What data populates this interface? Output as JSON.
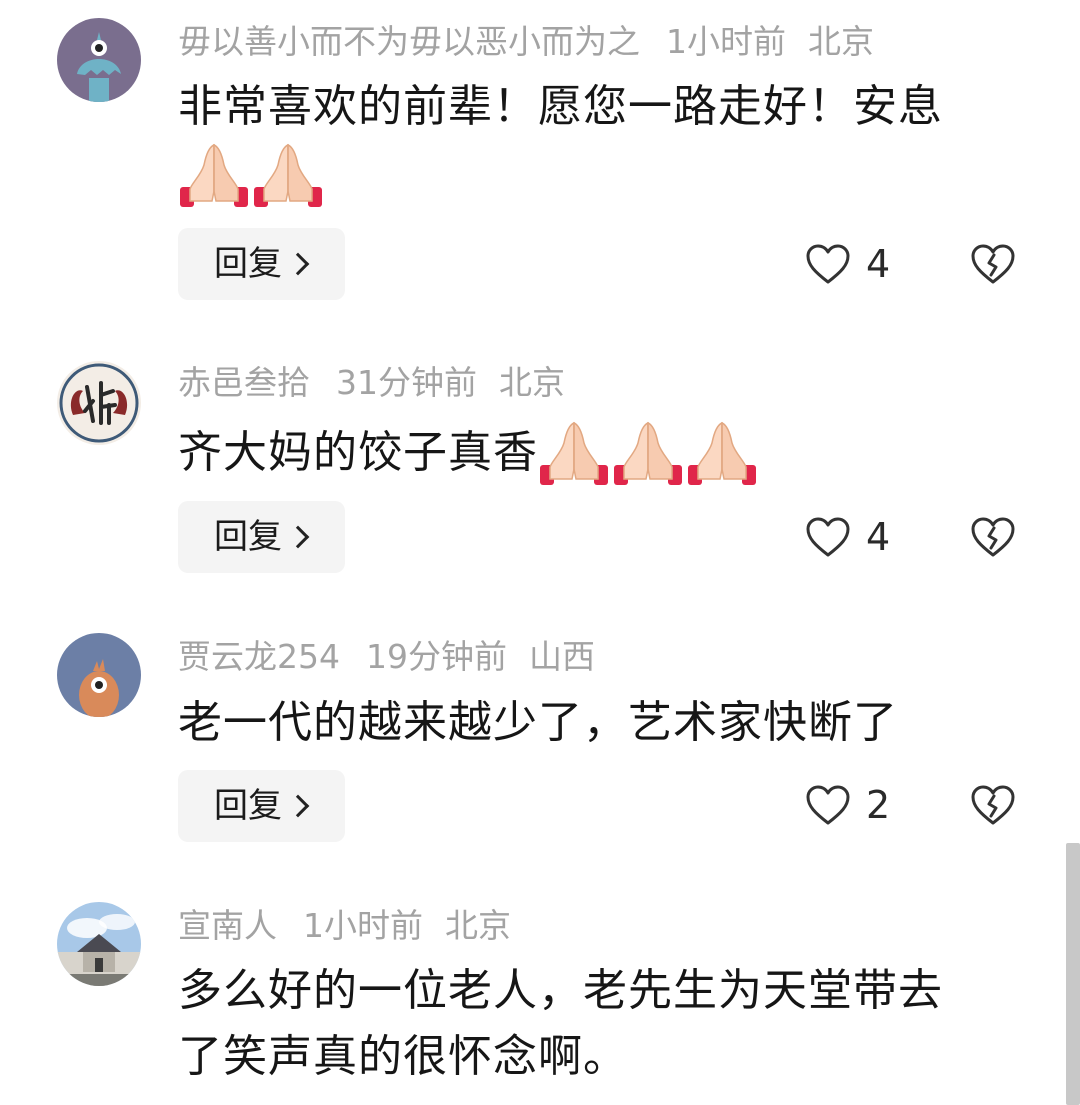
{
  "comments": [
    {
      "user": "毋以善小而不为毋以恶小而为之",
      "time": "1小时前",
      "location": "北京",
      "text": "非常喜欢的前辈！愿您一路走好！安息",
      "emoji": "pray",
      "emoji_count": 2,
      "reply_label": "回复",
      "likes": "4"
    },
    {
      "user": "赤邑叁拾",
      "time": "31分钟前",
      "location": "北京",
      "text": "齐大妈的饺子真香",
      "emoji": "pray",
      "emoji_count": 3,
      "reply_label": "回复",
      "likes": "4"
    },
    {
      "user": "贾云龙254",
      "time": "19分钟前",
      "location": "山西",
      "text": "老一代的越来越少了，艺术家快断了",
      "reply_label": "回复",
      "likes": "2"
    },
    {
      "user": "宣南人",
      "time": "1小时前",
      "location": "北京",
      "text_line1": "多么好的一位老人，老先生为天堂带去",
      "text_line2": "了笑声真的很怀念啊。"
    }
  ],
  "colors": {
    "meta": "#a3a3a3",
    "text": "#161616",
    "reply_bg": "#f4f4f4",
    "icon_stroke": "#333333"
  },
  "icons": {
    "like": "heart-outline-icon",
    "dislike": "broken-heart-icon",
    "reply_chevron": "chevron-right-icon",
    "emoji": "folded-hands-emoji"
  }
}
